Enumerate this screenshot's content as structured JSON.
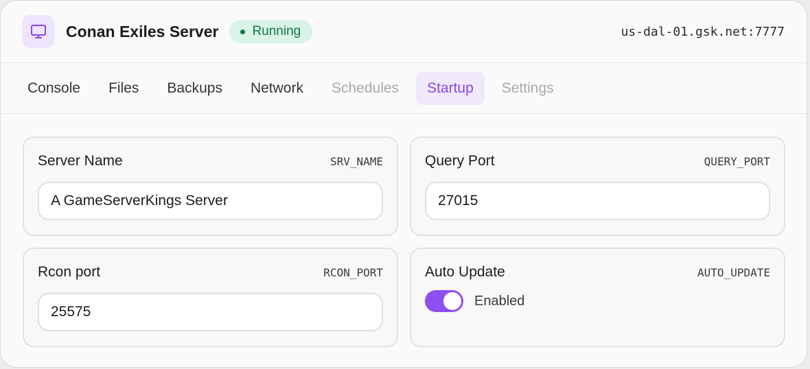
{
  "header": {
    "icon": "monitor-icon",
    "title": "Conan Exiles Server",
    "status": "Running",
    "address": "us-dal-01.gsk.net:7777",
    "colors": {
      "accent": "#8b45e6",
      "status": "#127846"
    }
  },
  "tabs": [
    {
      "label": "Console",
      "state": "normal"
    },
    {
      "label": "Files",
      "state": "normal"
    },
    {
      "label": "Backups",
      "state": "normal"
    },
    {
      "label": "Network",
      "state": "normal"
    },
    {
      "label": "Schedules",
      "state": "disabled"
    },
    {
      "label": "Startup",
      "state": "active"
    },
    {
      "label": "Settings",
      "state": "disabled"
    }
  ],
  "variables": [
    {
      "label": "Server Name",
      "var": "SRV_NAME",
      "value": "A GameServerKings Server"
    },
    {
      "label": "Query Port",
      "var": "QUERY_PORT",
      "value": "27015"
    },
    {
      "label": "Rcon port",
      "var": "RCON_PORT",
      "value": "25575"
    },
    {
      "label": "Auto Update",
      "var": "AUTO_UPDATE",
      "toggle_on": true,
      "toggle_label": "Enabled"
    }
  ]
}
